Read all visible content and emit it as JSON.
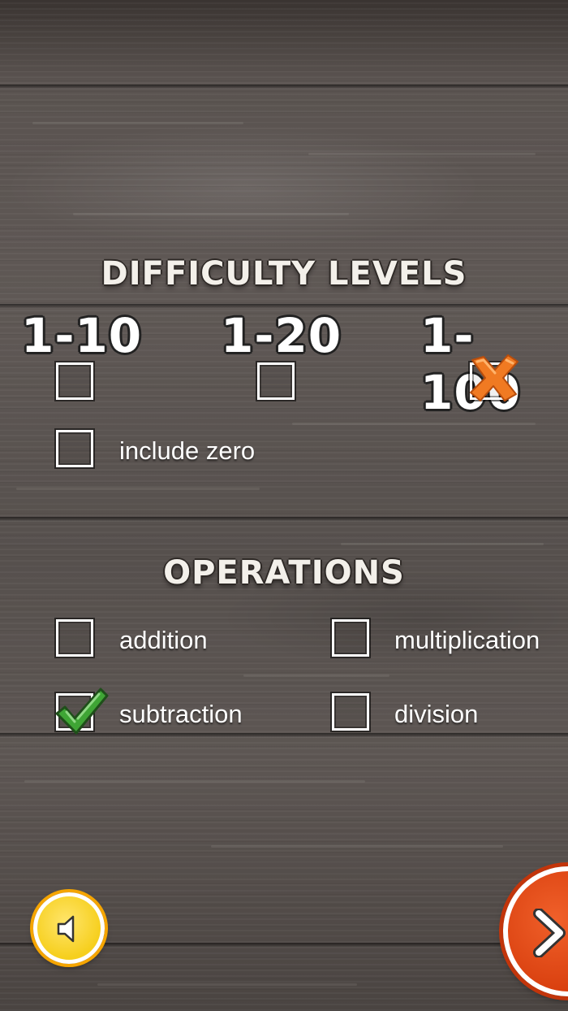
{
  "difficulty": {
    "title": "DIFFICULTY LEVELS",
    "levels": [
      {
        "label": "1-10",
        "selected": false
      },
      {
        "label": "1-20",
        "selected": false
      },
      {
        "label": "1-100",
        "selected": true
      }
    ],
    "include_zero": {
      "label": "include zero",
      "checked": false
    }
  },
  "operations": {
    "title": "OPERATIONS",
    "items": [
      {
        "label": "addition",
        "checked": false
      },
      {
        "label": "multiplication",
        "checked": false
      },
      {
        "label": "subtraction",
        "checked": true
      },
      {
        "label": "division",
        "checked": false
      }
    ]
  },
  "icons": {
    "sound": "speaker-icon",
    "next": "chevron-right-icon",
    "selected_mark": "x-mark-icon",
    "checked_mark": "checkmark-icon"
  },
  "colors": {
    "wood_background": "#5a5350",
    "sound_button": "#f6cf1d",
    "sound_button_ring": "#f5a500",
    "next_button": "#d9400f",
    "check_green": "#3fa535",
    "x_orange": "#f07a22"
  }
}
